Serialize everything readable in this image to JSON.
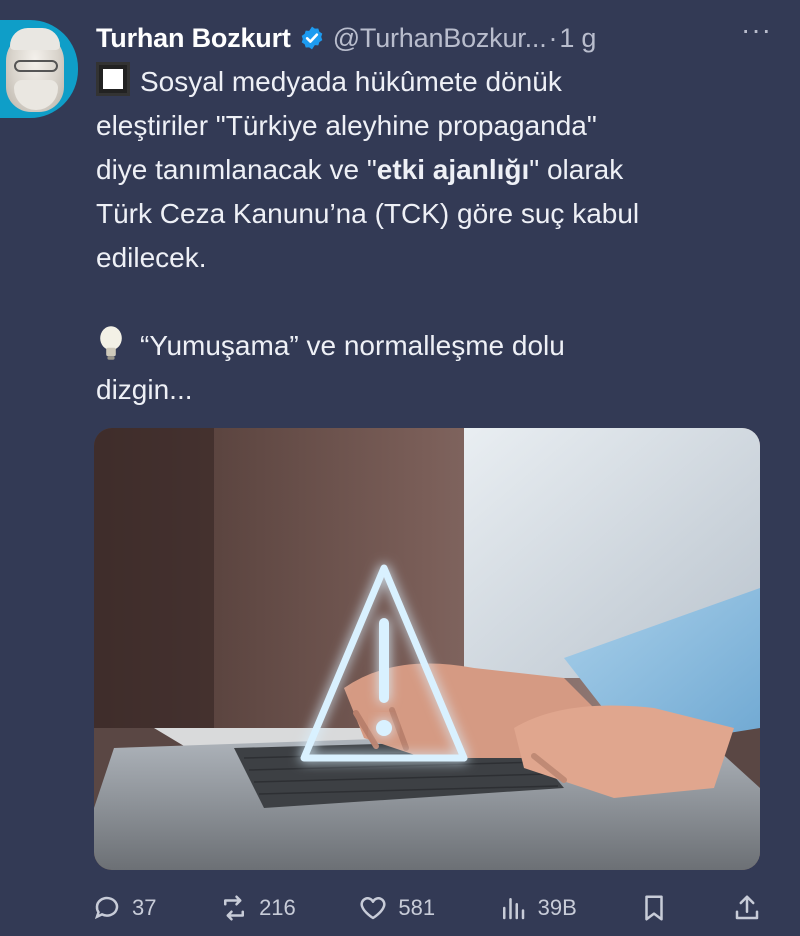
{
  "tweet": {
    "author_name": "Turhan Bozkurt",
    "handle": "@TurhanBozkur...",
    "separator": "·",
    "time": "1 g",
    "more": "···",
    "text": {
      "l1": "Sosyal medyada hükûmete dönük",
      "l2": "eleştiriler \"Türkiye aleyhine propaganda\"",
      "l3a": "diye tanımlanacak ve \"",
      "l3b": "etki ajanlığı",
      "l3c": "\" olarak",
      "l4": "Türk Ceza Kanunu’na (TCK) göre suç kabul",
      "l5": "edilecek.",
      "l6": "“Yumuşama” ve normalleşme dolu",
      "l7": "dizgin..."
    },
    "icons": {
      "para1": "black-square-button-emoji",
      "para2": "light-bulb-emoji",
      "verified": "verified-badge-icon"
    }
  },
  "actions": {
    "replies": "37",
    "reposts": "216",
    "likes": "581",
    "views": "39B"
  },
  "colors": {
    "background": "#333a55",
    "verified": "#1d9bf0",
    "muted": "#b9bdcd"
  }
}
